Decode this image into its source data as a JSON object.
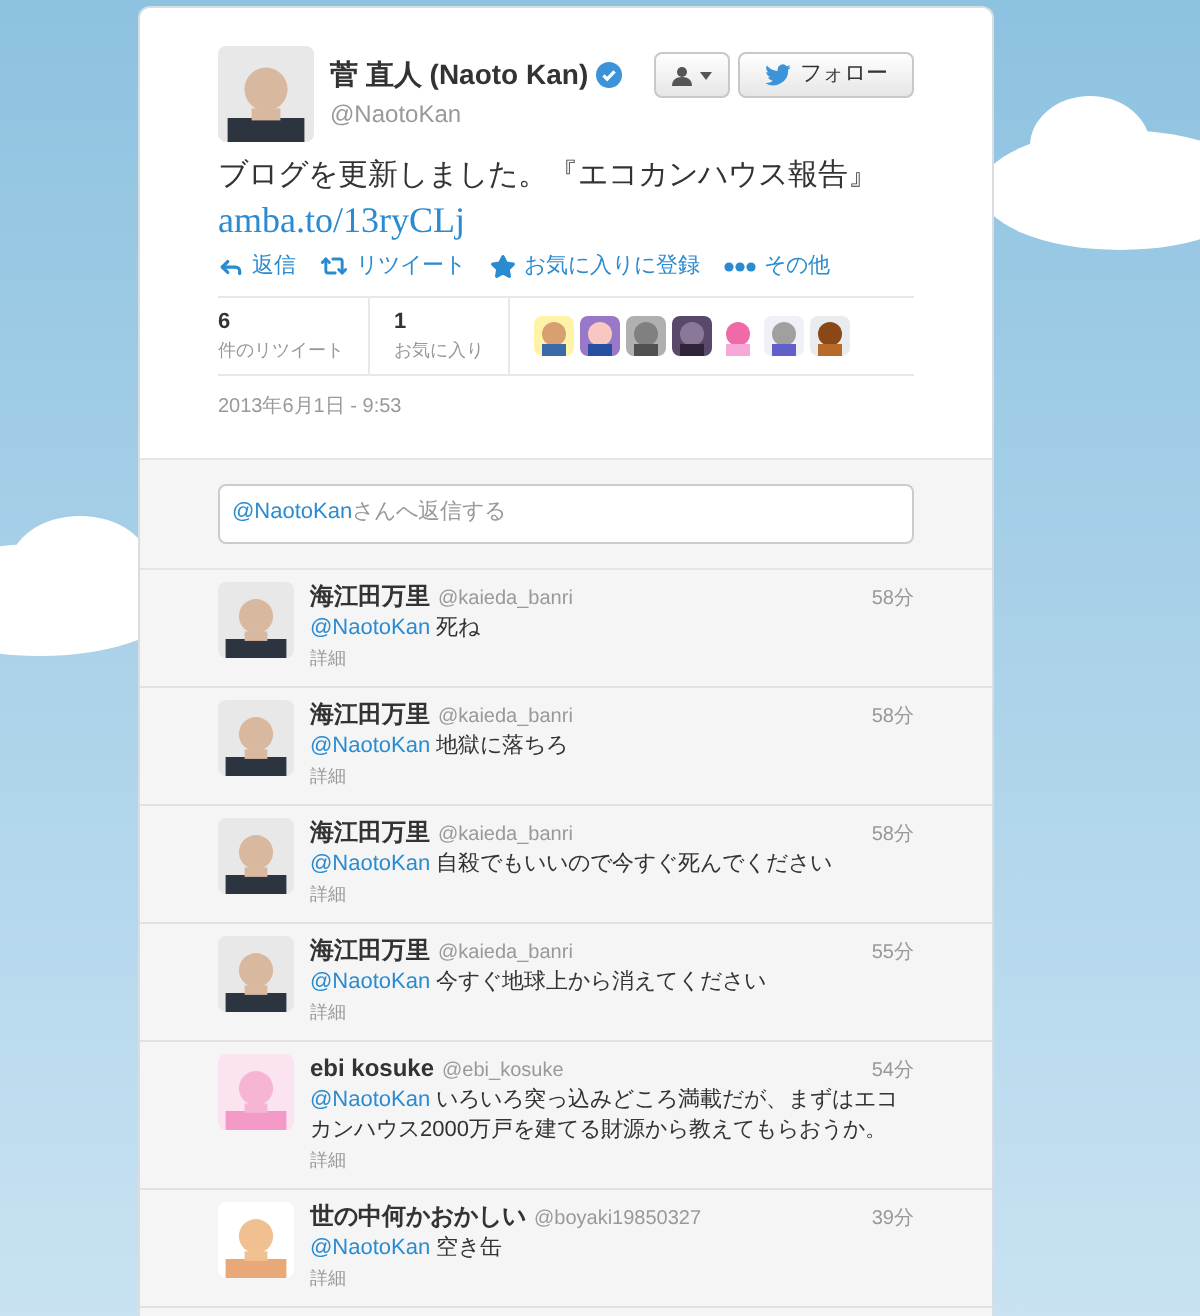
{
  "tweet": {
    "author": {
      "name": "菅 直人 (Naoto Kan)",
      "handle": "@NaotoKan",
      "verified": true
    },
    "buttons": [
      {
        "kind": "user-menu"
      },
      {
        "kind": "follow",
        "label": "フォロー"
      }
    ],
    "text": "ブログを更新しました。『エコカンハウス報告』",
    "link": "amba.to/13ryCLj",
    "actions": [
      {
        "kind": "reply",
        "label": "返信"
      },
      {
        "kind": "retweet",
        "label": "リツイート"
      },
      {
        "kind": "favorite",
        "label": "お気に入りに登録"
      },
      {
        "kind": "more",
        "label": "その他"
      }
    ],
    "stats": [
      {
        "count": "6",
        "label": "件のリツイート"
      },
      {
        "count": "1",
        "label": "お気に入り"
      }
    ],
    "date": "2013年6月1日 - 9:53"
  },
  "reply_box": {
    "mention": "@NaotoKan",
    "placeholder": "さんへ返信する"
  },
  "replies": [
    {
      "name": "海江田万里",
      "handle": "@kaieda_banri",
      "time": "58分",
      "mention": "@NaotoKan",
      "text": "死ね",
      "details": "詳細"
    },
    {
      "name": "海江田万里",
      "handle": "@kaieda_banri",
      "time": "58分",
      "mention": "@NaotoKan",
      "text": "地獄に落ちろ",
      "details": "詳細"
    },
    {
      "name": "海江田万里",
      "handle": "@kaieda_banri",
      "time": "58分",
      "mention": "@NaotoKan",
      "text": "自殺でもいいので今すぐ死んでください",
      "details": "詳細"
    },
    {
      "name": "海江田万里",
      "handle": "@kaieda_banri",
      "time": "55分",
      "mention": "@NaotoKan",
      "text": "今すぐ地球上から消えてください",
      "details": "詳細"
    },
    {
      "name": "ebi kosuke",
      "handle": "@ebi_kosuke",
      "time": "54分",
      "mention": "@NaotoKan",
      "text": "いろいろ突っ込みどころ満載だが、まずはエコカンハウス2000万戸を建てる財源から教えてもらおうか。",
      "details": "詳細"
    },
    {
      "name": "世の中何かおかしい",
      "handle": "@boyaki19850327",
      "time": "39分",
      "mention": "@NaotoKan",
      "text": "空き缶",
      "details": "詳細"
    }
  ]
}
